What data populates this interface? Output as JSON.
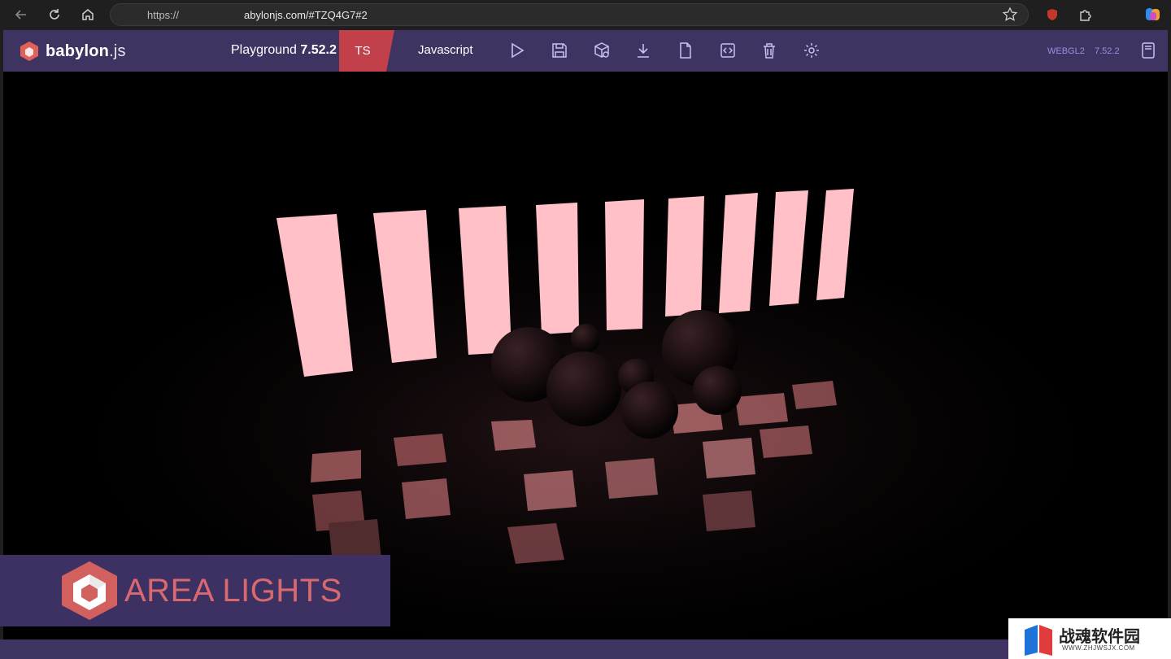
{
  "browser": {
    "url_prefix": "https://",
    "url_host": "abylonjs.com/#TZQ4G7#2"
  },
  "header": {
    "logo_main": "babylon",
    "logo_suffix": ".js",
    "playground_label": "Playground",
    "playground_version": "7.52.2",
    "ts_tab": "TS",
    "js_tab": "Javascript",
    "engine": "WEBGL2",
    "engine_version": "7.52.2"
  },
  "toolbar_icons": [
    "play-icon",
    "save-icon",
    "box-settings-icon",
    "download-icon",
    "new-file-icon",
    "code-icon",
    "trash-icon",
    "gear-icon"
  ],
  "overlay": {
    "title": "AREA LIGHTS"
  },
  "watermark": {
    "cn": "战魂软件园",
    "url": "WWW.ZHJWSJX.COM"
  },
  "colors": {
    "header_bg": "#3f3461",
    "ts_tab": "#c1404a",
    "accent_text": "#9b8fe0",
    "panel_light": "#ffc0c8",
    "overlay_text": "#d86a6f"
  }
}
